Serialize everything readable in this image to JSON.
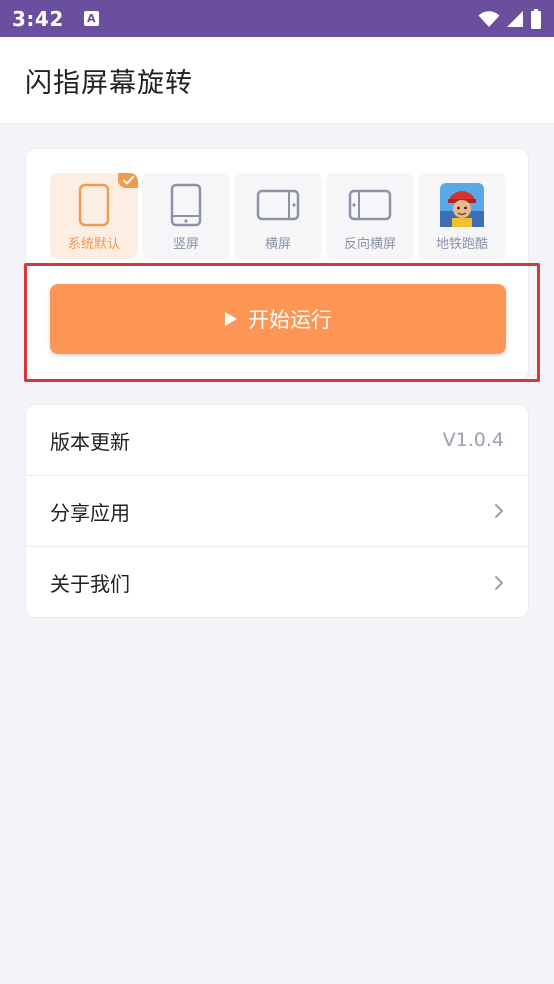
{
  "status_bar": {
    "time": "3:42",
    "notif_glyph": "A",
    "icons": [
      "wifi-icon",
      "signal-icon",
      "battery-icon"
    ]
  },
  "app": {
    "title": "闪指屏幕旋转"
  },
  "modes": [
    {
      "label": "系统默认",
      "icon": "phone-outline-icon",
      "selected": true
    },
    {
      "label": "竖屏",
      "icon": "tablet-portrait-icon",
      "selected": false
    },
    {
      "label": "横屏",
      "icon": "tablet-landscape-icon",
      "selected": false
    },
    {
      "label": "反向横屏",
      "icon": "tablet-landscape-reverse-icon",
      "selected": false
    },
    {
      "label": "地铁跑酷",
      "icon": "subway-surfers-app-icon",
      "selected": false
    }
  ],
  "start_button": {
    "label": "开始运行",
    "icon": "play-icon"
  },
  "menu": [
    {
      "label": "版本更新",
      "value": "V1.0.4"
    },
    {
      "label": "分享应用",
      "icon": "chevron-right-icon"
    },
    {
      "label": "关于我们",
      "icon": "chevron-right-icon"
    }
  ],
  "colors": {
    "status_bar": "#6a4f9e",
    "accent": "#fd9654",
    "selected_bg": "#fdeee3",
    "highlight": "#d33a36"
  }
}
